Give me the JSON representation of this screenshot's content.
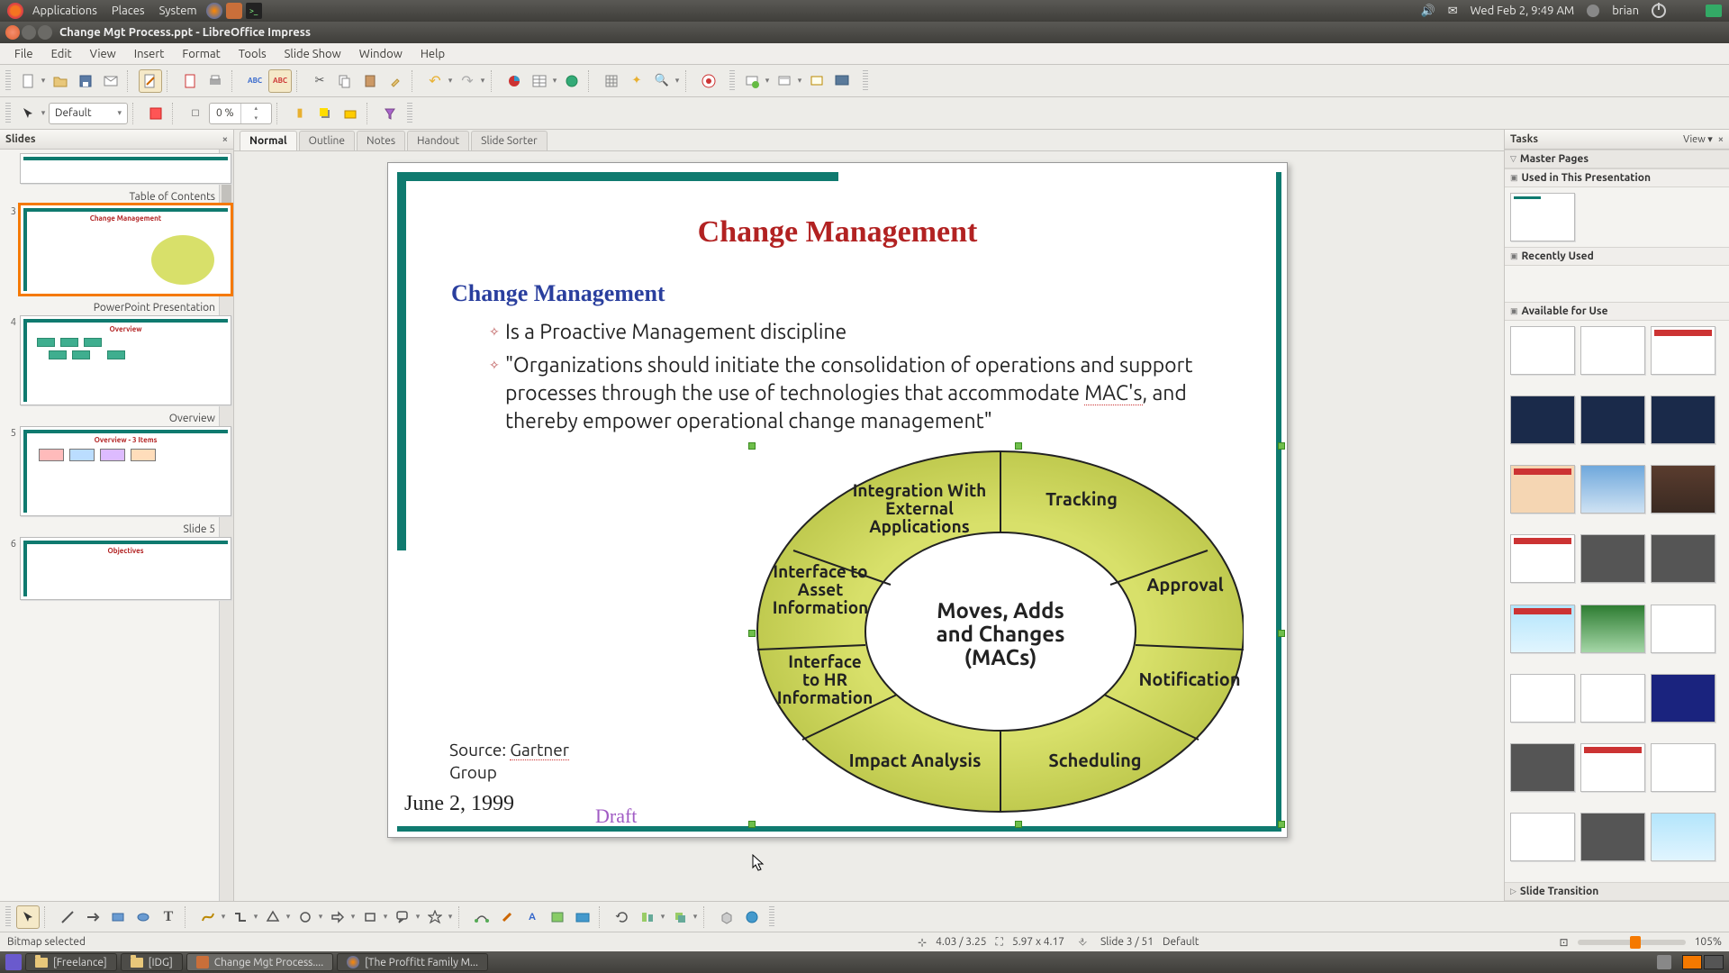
{
  "os": {
    "menus": {
      "apps": "Applications",
      "places": "Places",
      "system": "System"
    },
    "clock": "Wed Feb  2,  9:49 AM",
    "user": "brian"
  },
  "window": {
    "title": "Change Mgt Process.ppt - LibreOffice Impress"
  },
  "menubar": {
    "file": "File",
    "edit": "Edit",
    "view": "View",
    "insert": "Insert",
    "format": "Format",
    "tools": "Tools",
    "slideshow": "Slide Show",
    "window": "Window",
    "help": "Help"
  },
  "paragraph": {
    "style": "Default",
    "indent": "0 %"
  },
  "slides_panel": {
    "title": "Slides",
    "items": [
      {
        "num": "",
        "label": "Table of Contents"
      },
      {
        "num": "3",
        "label": "PowerPoint Presentation"
      },
      {
        "num": "4",
        "label": "Overview"
      },
      {
        "num": "5",
        "label": "Slide 5"
      },
      {
        "num": "6",
        "label": ""
      }
    ]
  },
  "viewtabs": {
    "normal": "Normal",
    "outline": "Outline",
    "notes": "Notes",
    "handout": "Handout",
    "sorter": "Slide Sorter"
  },
  "slide": {
    "title": "Change Management",
    "subtitle": "Change Management",
    "bullet1": "Is a Proactive Management discipline",
    "bullet2a": "\"Organizations should initiate the consolidation of operations and support processes through the use of technologies that accommodate ",
    "bullet2b": "MAC's",
    "bullet2c": ", and thereby empower operational change management\"",
    "source_label": "Source: ",
    "source_name": "Gartner",
    "source_group": "Group",
    "date": "June 2, 1999",
    "draft": "Draft",
    "donut_center1": "Moves, Adds",
    "donut_center2": "and Changes",
    "donut_center3": "(MACs)",
    "seg": {
      "integration1": "Integration With",
      "integration2": "External",
      "integration3": "Applications",
      "tracking": "Tracking",
      "asset1": "Interface to",
      "asset2": "Asset",
      "asset3": "Information",
      "approval": "Approval",
      "hr1": "Interface",
      "hr2": "to HR",
      "hr3": "Information",
      "notification": "Notification",
      "impact": "Impact Analysis",
      "scheduling": "Scheduling"
    }
  },
  "tasks": {
    "title": "Tasks",
    "view": "View",
    "sections": {
      "master": "Master Pages",
      "used": "Used in This Presentation",
      "recent": "Recently Used",
      "avail": "Available for Use",
      "trans": "Slide Transition"
    }
  },
  "status": {
    "sel": "Bitmap selected",
    "pos": "4.03 / 3.25",
    "size": "5.97 x 4.17",
    "slide": "Slide 3 / 51",
    "master": "Default",
    "zoom": "105%"
  },
  "thumbs_extra": {
    "t4": "Overview",
    "t5": "Overview - 3 Items",
    "t6": "Objectives"
  },
  "taskbar": {
    "freelance": "[Freelance]",
    "idg": "[IDG]",
    "doc": "Change Mgt Process....",
    "web": "[The Proffitt Family M..."
  }
}
